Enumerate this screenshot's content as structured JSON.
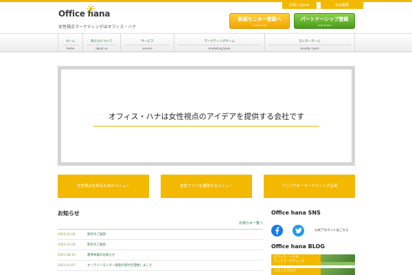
{
  "header": {
    "logo_text": "Office hana",
    "tagline": "女性視点マーケティングはオフィス・ハナ",
    "util_links": [
      {
        "label": "お問い合わせ"
      },
      {
        "label": "会社概要"
      }
    ],
    "cta_monitor": {
      "label": "新規モニター登録へ",
      "sub": "monitor site"
    },
    "cta_partner": {
      "label": "パートナーシップ登録",
      "sub": "partnership"
    }
  },
  "nav": {
    "items": [
      {
        "ja": "ホーム",
        "en": "home"
      },
      {
        "ja": "私たちについて",
        "en": "about us"
      },
      {
        "ja": "サービス",
        "en": "service"
      },
      {
        "ja": "マーケティングチーム",
        "en": "marketing team"
      },
      {
        "ja": "モニターチーム",
        "en": "monitor team"
      }
    ]
  },
  "hero": {
    "text": "オフィス・ハナは女性視点のアイデアを提供する会社です"
  },
  "menus": [
    {
      "label": "女性視点を知るためのメニュー"
    },
    {
      "label": "女性ファンを獲得するメニュー"
    },
    {
      "label": "アンバサダーマーケティング企画"
    }
  ],
  "news": {
    "title": "お知らせ",
    "more_label": "お知らせ一覧へ",
    "rows": [
      {
        "date": "2023.01.04",
        "text": "新年のご挨拶"
      },
      {
        "date": "2022.01.03",
        "text": "新年のご挨拶"
      },
      {
        "date": "2021.08.10",
        "text": "夏季休業のお知らせ"
      },
      {
        "date": "2021.01.07",
        "text": "オンラインモニター調査の受付を開始しました"
      }
    ]
  },
  "side": {
    "sns_title": "Office hana SNS",
    "sns_text": "公式アカウントはこちら",
    "blog_title": "Office hana BLOG",
    "blog_banners": [
      {
        "text": "オフィス・ハナの\nラニアマーケティング"
      },
      {
        "text": "スタッフブログ"
      }
    ]
  },
  "colors": {
    "accent": "#f3b800",
    "green": "#2b7a3c"
  }
}
